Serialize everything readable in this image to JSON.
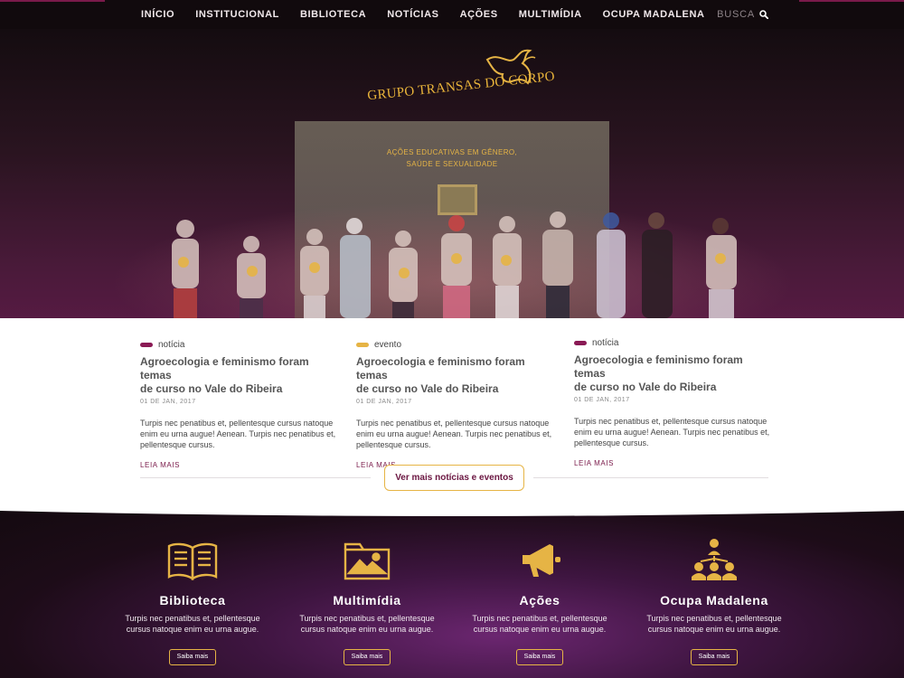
{
  "nav": {
    "items": [
      "INÍCIO",
      "INSTITUCIONAL",
      "BIBLIOTECA",
      "NOTÍCIAS",
      "AÇÕES",
      "MULTIMÍDIA",
      "OCUPA MADALENA"
    ],
    "search_label": "BUSCA"
  },
  "hero": {
    "logo_text": "GRUPO TRANSAS DO CORPO",
    "tagline_line1": "AÇÕES EDUCATIVAS EM GÊNERO,",
    "tagline_line2": "SAÚDE E SEXUALIDADE"
  },
  "news": {
    "cards": [
      {
        "tag": "notícia",
        "tag_color": "#8a1a55",
        "title_line1": "Agroecologia e feminismo foram temas",
        "title_line2": "de curso no Vale do Ribeira",
        "date": "01 DE JAN, 2017",
        "text_line1": "Turpis nec penatibus et, pellentesque cursus natoque",
        "text_line2": "enim eu urna augue! Aenean. Turpis nec penatibus et,",
        "text_line3": "pellentesque cursus.",
        "more": "LEIA MAIS"
      },
      {
        "tag": "evento",
        "tag_color": "#e6b445",
        "title_line1": "Agroecologia e feminismo foram temas",
        "title_line2": "de curso no Vale do Ribeira",
        "date": "01 DE JAN, 2017",
        "text_line1": "Turpis nec penatibus et, pellentesque cursus natoque",
        "text_line2": "enim eu urna augue! Aenean. Turpis nec penatibus et,",
        "text_line3": "pellentesque cursus.",
        "more": "LEIA MAIS"
      },
      {
        "tag": "notícia",
        "tag_color": "#8a1a55",
        "title_line1": "Agroecologia e feminismo foram temas",
        "title_line2": "de curso no Vale do Ribeira",
        "date": "01 DE JAN, 2017",
        "text_line1": "Turpis nec penatibus et, pellentesque cursus natoque",
        "text_line2": "enim eu urna augue! Aenean. Turpis nec penatibus et,",
        "text_line3": "pellentesque cursus.",
        "more": "LEIA MAIS"
      }
    ],
    "more_button": "Ver mais notícias e eventos"
  },
  "features": [
    {
      "title": "Biblioteca",
      "icon": "book-icon",
      "text_line1": "Turpis nec penatibus et, pellentesque",
      "text_line2": "cursus natoque enim eu urna augue.",
      "button": "Saiba mais"
    },
    {
      "title": "Multimídia",
      "icon": "media-folder-icon",
      "text_line1": "Turpis nec penatibus et, pellentesque",
      "text_line2": "cursus natoque enim eu urna augue.",
      "button": "Saiba mais"
    },
    {
      "title": "Ações",
      "icon": "megaphone-icon",
      "text_line1": "Turpis nec penatibus et, pellentesque",
      "text_line2": "cursus natoque enim eu urna augue.",
      "button": "Saiba mais"
    },
    {
      "title": "Ocupa Madalena",
      "icon": "group-network-icon",
      "text_line1": "Turpis nec penatibus et, pellentesque",
      "text_line2": "cursus natoque enim eu urna augue.",
      "button": "Saiba mais"
    }
  ],
  "colors": {
    "accent_gold": "#e6b445",
    "accent_magenta": "#8a1a55",
    "nav_bg": "#110a0d"
  }
}
